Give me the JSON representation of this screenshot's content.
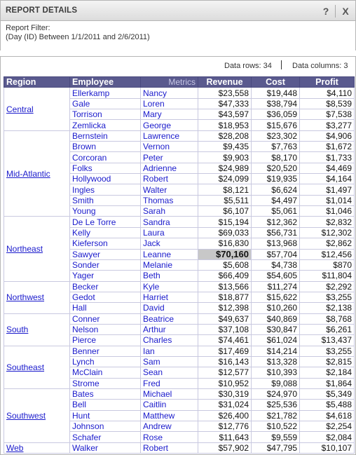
{
  "header": {
    "title": "REPORT DETAILS",
    "help_label": "?",
    "close_label": "X"
  },
  "filter": {
    "label": "Report Filter:",
    "expression": "(Day (ID) Between 1/1/2011 and 2/6/2011)"
  },
  "stats": {
    "rows": "Data rows: 34",
    "cols": "Data columns: 3"
  },
  "columns": {
    "region": "Region",
    "employee": "Employee",
    "metrics": "Metrics",
    "revenue": "Revenue",
    "cost": "Cost",
    "profit": "Profit"
  },
  "highlight_color": "#c8c8c8",
  "header_color": "#5a5a8e",
  "link_color": "#1a1acc",
  "regions": [
    {
      "name": "Central",
      "rows": [
        [
          "Ellerkamp",
          "Nancy",
          "$23,558",
          "$19,448",
          "$4,110"
        ],
        [
          "Gale",
          "Loren",
          "$47,333",
          "$38,794",
          "$8,539"
        ],
        [
          "Torrison",
          "Mary",
          "$43,597",
          "$36,059",
          "$7,538"
        ],
        [
          "Zemlicka",
          "George",
          "$18,953",
          "$15,676",
          "$3,277"
        ]
      ]
    },
    {
      "name": "Mid-Atlantic",
      "rows": [
        [
          "Bernstein",
          "Lawrence",
          "$28,208",
          "$23,302",
          "$4,906"
        ],
        [
          "Brown",
          "Vernon",
          "$9,435",
          "$7,763",
          "$1,672"
        ],
        [
          "Corcoran",
          "Peter",
          "$9,903",
          "$8,170",
          "$1,733"
        ],
        [
          "Folks",
          "Adrienne",
          "$24,989",
          "$20,520",
          "$4,469"
        ],
        [
          "Hollywood",
          "Robert",
          "$24,099",
          "$19,935",
          "$4,164"
        ],
        [
          "Ingles",
          "Walter",
          "$8,121",
          "$6,624",
          "$1,497"
        ],
        [
          "Smith",
          "Thomas",
          "$5,511",
          "$4,497",
          "$1,014"
        ],
        [
          "Young",
          "Sarah",
          "$6,107",
          "$5,061",
          "$1,046"
        ]
      ]
    },
    {
      "name": "Northeast",
      "rows": [
        [
          "De Le Torre",
          "Sandra",
          "$15,194",
          "$12,362",
          "$2,832"
        ],
        [
          "Kelly",
          "Laura",
          "$69,033",
          "$56,731",
          "$12,302"
        ],
        [
          "Kieferson",
          "Jack",
          "$16,830",
          "$13,968",
          "$2,862"
        ],
        [
          "Sawyer",
          "Leanne",
          "$70,160",
          "$57,704",
          "$12,456"
        ],
        [
          "Sonder",
          "Melanie",
          "$5,608",
          "$4,738",
          "$870"
        ],
        [
          "Yager",
          "Beth",
          "$66,409",
          "$54,605",
          "$11,804"
        ]
      ]
    },
    {
      "name": "Northwest",
      "rows": [
        [
          "Becker",
          "Kyle",
          "$13,566",
          "$11,274",
          "$2,292"
        ],
        [
          "Gedot",
          "Harriet",
          "$18,877",
          "$15,622",
          "$3,255"
        ],
        [
          "Hall",
          "David",
          "$12,398",
          "$10,260",
          "$2,138"
        ]
      ]
    },
    {
      "name": "South",
      "rows": [
        [
          "Conner",
          "Beatrice",
          "$49,637",
          "$40,869",
          "$8,768"
        ],
        [
          "Nelson",
          "Arthur",
          "$37,108",
          "$30,847",
          "$6,261"
        ],
        [
          "Pierce",
          "Charles",
          "$74,461",
          "$61,024",
          "$13,437"
        ]
      ]
    },
    {
      "name": "Southeast",
      "rows": [
        [
          "Benner",
          "Ian",
          "$17,469",
          "$14,214",
          "$3,255"
        ],
        [
          "Lynch",
          "Sam",
          "$16,143",
          "$13,328",
          "$2,815"
        ],
        [
          "McClain",
          "Sean",
          "$12,577",
          "$10,393",
          "$2,184"
        ],
        [
          "Strome",
          "Fred",
          "$10,952",
          "$9,088",
          "$1,864"
        ]
      ]
    },
    {
      "name": "Southwest",
      "rows": [
        [
          "Bates",
          "Michael",
          "$30,319",
          "$24,970",
          "$5,349"
        ],
        [
          "Bell",
          "Caitlin",
          "$31,024",
          "$25,536",
          "$5,488"
        ],
        [
          "Hunt",
          "Matthew",
          "$26,400",
          "$21,782",
          "$4,618"
        ],
        [
          "Johnson",
          "Andrew",
          "$12,776",
          "$10,522",
          "$2,254"
        ],
        [
          "Schafer",
          "Rose",
          "$11,643",
          "$9,559",
          "$2,084"
        ]
      ]
    },
    {
      "name": "Web",
      "rows": [
        [
          "Walker",
          "Robert",
          "$57,902",
          "$47,795",
          "$10,107"
        ]
      ]
    }
  ],
  "highlighted_cell": {
    "region": "Northeast",
    "row": 3,
    "col": "revenue"
  }
}
